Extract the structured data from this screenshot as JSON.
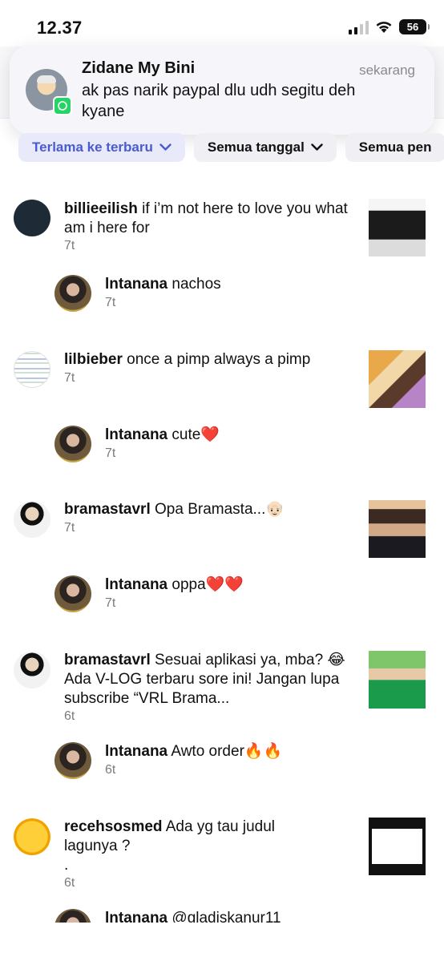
{
  "status_bar": {
    "time": "12.37",
    "battery": "56"
  },
  "notification": {
    "app_icon": "whatsapp-icon",
    "sender": "Zidane My Bini",
    "time": "sekarang",
    "message": "ak pas narik paypal dlu udh segitu deh kyane"
  },
  "filters": [
    {
      "label": "Terlama ke terbaru",
      "active": true
    },
    {
      "label": "Semua tanggal",
      "active": false
    },
    {
      "label": "Semua pen",
      "active": false
    }
  ],
  "comments": [
    {
      "user": "billieeilish",
      "text": "if i’m not here to love you what am i here for",
      "time": "7t"
    },
    {
      "user": "lntanana",
      "text": "nachos",
      "time": "7t"
    },
    {
      "user": "lilbieber",
      "text": "once a pimp always a pimp",
      "time": "7t"
    },
    {
      "user": "lntanana",
      "text": "cute❤️",
      "time": "7t"
    },
    {
      "user": "bramastavrl",
      "text": "Opa Bramasta...👴🏻",
      "time": "7t"
    },
    {
      "user": "lntanana",
      "text": "oppa❤️❤️",
      "time": "7t"
    },
    {
      "user": "bramastavrl",
      "text": "Sesuai aplikasi ya, mba? 😂 Ada V-LOG terbaru sore ini! Jangan lupa subscribe “VRL Brama...",
      "time": "6t"
    },
    {
      "user": "lntanana",
      "text": "Awto order🔥🔥",
      "time": "6t"
    },
    {
      "user": "recehsosmed",
      "text": "Ada yg tau judul lagunya ?",
      "text2": ".",
      "time": "6t"
    },
    {
      "user": "lntanana",
      "text": "@gladiskanur11",
      "time": ""
    }
  ]
}
